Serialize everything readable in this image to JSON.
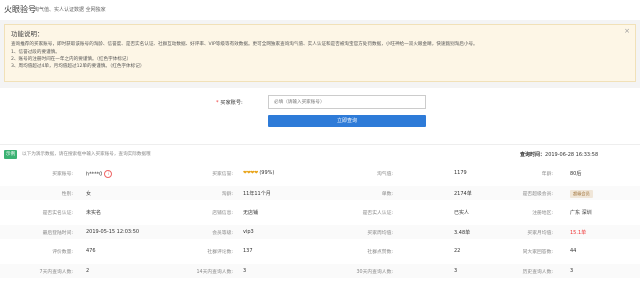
{
  "header": {
    "title": "火眼验号",
    "subtitle": "淘气值、实人认证数据 全网独家"
  },
  "notice": {
    "title": "功能说明：",
    "lines": [
      "查询推荐的买家账号，即时获取该账号的淘龄、信誉度、是否实名认证、社群互动数据、好评率、VIP等级等有效数据。更可全网独家查询淘气值、实人认证和是否被淘宝官方处罚数据，小旺神给一双火眼金睛，快速甄别淘后小号。",
      "1、信誉过段的要谨慎。",
      "2、账号的注册时间在一年之内的要谨慎。（红色字体标记）",
      "3、周均值超过4单，月均值超过12单的要谨慎。（红色字体标记）"
    ],
    "close": "×"
  },
  "form": {
    "label": "买家账号:",
    "required_mark": "*",
    "placeholder": "必填（请输入买家账号）",
    "submit": "立即查询"
  },
  "result": {
    "tag": "示例",
    "desc": "以下为演示数据，请在搜索框中输入买家账号，查询实际数据哦",
    "time_label": "查询时间：",
    "time_value": "2019-06-28 16:33:58"
  },
  "rows": [
    [
      {
        "l": "买家账号:",
        "v": "h****0",
        "icon": "id"
      },
      {
        "l": "买家信誉:",
        "v": "(99%)",
        "hearts": "❤❤❤❤"
      },
      {
        "l": "淘气值:",
        "v": "1179"
      },
      {
        "l": "年龄:",
        "v": "80后"
      }
    ],
    [
      {
        "l": "性别:",
        "v": "女"
      },
      {
        "l": "淘龄:",
        "v": "11年11个月"
      },
      {
        "l": "单数:",
        "v": "2174单"
      },
      {
        "l": "是否超级会员:",
        "v": "超级会员",
        "tmall": true
      }
    ],
    [
      {
        "l": "是否实名认证:",
        "v": "未实名"
      },
      {
        "l": "店铺信息:",
        "v": "无店铺"
      },
      {
        "l": "是否实人认证:",
        "v": "已实人"
      },
      {
        "l": "注册地区:",
        "v": "广东 深圳"
      }
    ],
    [
      {
        "l": "最后登陆时间:",
        "v": "2019-05-15 12:03:50"
      },
      {
        "l": "会员等级:",
        "v": "vip3"
      },
      {
        "l": "买家周均值:",
        "v": "3.48单"
      },
      {
        "l": "买家月均值:",
        "v": "15.1单",
        "red": true
      }
    ],
    [
      {
        "l": "评价数量:",
        "v": "476"
      },
      {
        "l": "社群评论数:",
        "v": "137"
      },
      {
        "l": "社群点赞数:",
        "v": "22"
      },
      {
        "l": "同大家回答数:",
        "v": "44"
      }
    ],
    [
      {
        "l": "7天内查询人数:",
        "v": "2"
      },
      {
        "l": "14天内查询人数:",
        "v": "3"
      },
      {
        "l": "30天内查询人数:",
        "v": "3"
      },
      {
        "l": "历史查询人数:",
        "v": "3"
      }
    ]
  ]
}
